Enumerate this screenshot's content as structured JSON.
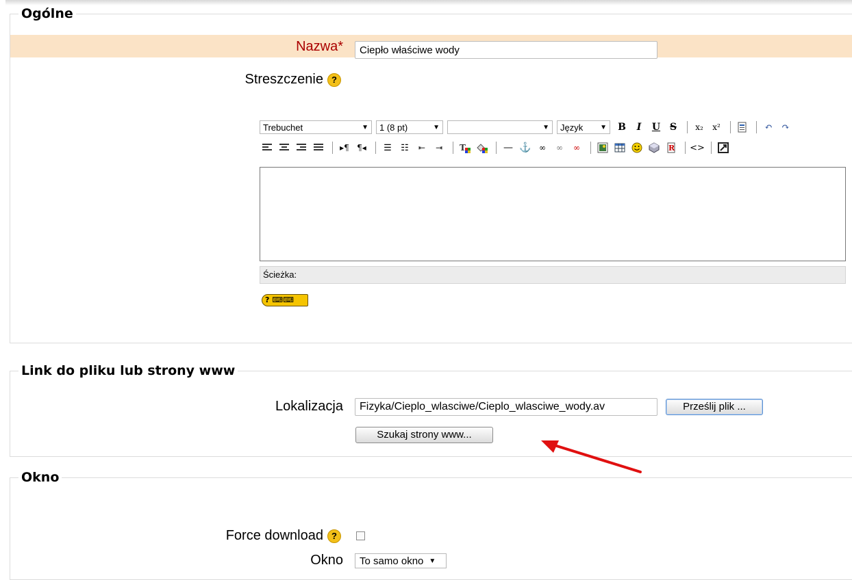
{
  "sections": {
    "general": {
      "legend": "Ogólne"
    },
    "link": {
      "legend": "Link do pliku lub strony www"
    },
    "window": {
      "legend": "Okno"
    }
  },
  "form": {
    "name_label": "Nazwa",
    "name_required": "*",
    "name_value": "Ciepło właściwe wody",
    "summary_label": "Streszczenie",
    "location_label": "Lokalizacja",
    "location_value": "Fizyka/Cieplo_wlasciwe/Cieplo_wlasciwe_wody.av",
    "upload_button": "Prześlij plik ...",
    "search_web_button": "Szukaj strony www...",
    "force_download_label": "Force download",
    "window_label": "Okno",
    "window_value": "To samo okno"
  },
  "editor": {
    "font_family": "Trebuchet",
    "font_size": "1 (8 pt)",
    "format": "",
    "language": "Język",
    "path_label": "Ścieżka:",
    "keyboard_help": "?"
  },
  "icons": [
    "help-icon",
    "bold-icon",
    "italic-icon",
    "underline-icon",
    "strikethrough-icon",
    "subscript-icon",
    "superscript-icon",
    "paste-word-icon",
    "undo-icon",
    "redo-icon",
    "align-left-icon",
    "align-center-icon",
    "align-right-icon",
    "justify-icon",
    "ltr-icon",
    "rtl-icon",
    "ordered-list-icon",
    "unordered-list-icon",
    "outdent-icon",
    "indent-icon",
    "text-color-icon",
    "background-color-icon",
    "horizontal-rule-icon",
    "anchor-icon",
    "link-icon",
    "unlink-icon",
    "nolink-icon",
    "image-icon",
    "table-icon",
    "smiley-icon",
    "special-char-icon",
    "search-replace-icon",
    "html-source-icon",
    "fullscreen-icon",
    "keyboard-icon",
    "red-arrow-annotation"
  ],
  "colors": {
    "highlight_row": "#fbe3c6",
    "required": "#aa0000",
    "arrow": "#e01010"
  }
}
